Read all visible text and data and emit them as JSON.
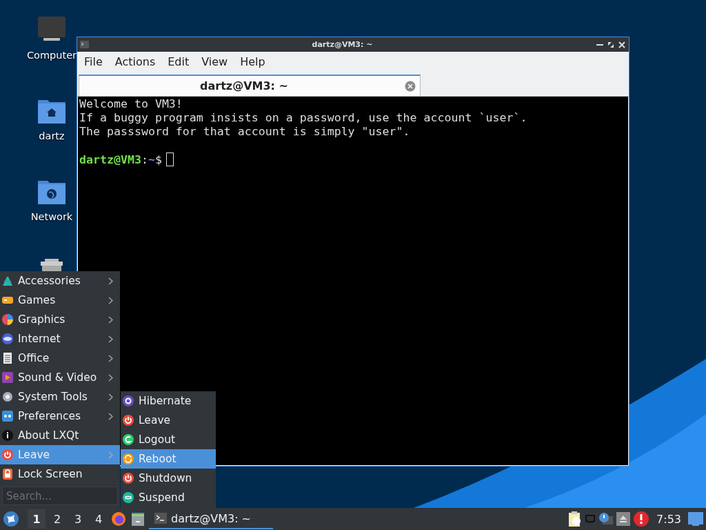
{
  "desktop_icons": [
    {
      "kind": "computer",
      "label": "Computer"
    },
    {
      "kind": "home",
      "label": "dartz"
    },
    {
      "kind": "network",
      "label": "Network"
    },
    {
      "kind": "trash"
    }
  ],
  "terminal": {
    "title": "dartz@VM3: ~",
    "menu": [
      "File",
      "Actions",
      "Edit",
      "View",
      "Help"
    ],
    "tabs": [
      {
        "label": "dartz@VM3: ~",
        "selected": true
      }
    ],
    "lines": [
      "Welcome to VM3!",
      "If a buggy program insists on a password, use the account `user`.",
      "The passsword for that account is simply \"user\"."
    ],
    "prompt": {
      "user_host": "dartz@VM3",
      "separator": ":",
      "path": "~",
      "symbol": "$"
    }
  },
  "start_menu": {
    "items": [
      {
        "kind": "accessories",
        "label": "Accessories",
        "has_submenu": true,
        "selected": false
      },
      {
        "kind": "games",
        "label": "Games",
        "has_submenu": true,
        "selected": false
      },
      {
        "kind": "graphics",
        "label": "Graphics",
        "has_submenu": true,
        "selected": false
      },
      {
        "kind": "internet",
        "label": "Internet",
        "has_submenu": true,
        "selected": false
      },
      {
        "kind": "office",
        "label": "Office",
        "has_submenu": true,
        "selected": false
      },
      {
        "kind": "sound-video",
        "label": "Sound & Video",
        "has_submenu": true,
        "selected": false
      },
      {
        "kind": "system-tools",
        "label": "System Tools",
        "has_submenu": true,
        "selected": false
      },
      {
        "kind": "preferences",
        "label": "Preferences",
        "has_submenu": true,
        "selected": false
      },
      {
        "kind": "about",
        "label": "About LXQt",
        "has_submenu": false,
        "selected": false
      },
      {
        "kind": "leave",
        "label": "Leave",
        "has_submenu": true,
        "selected": true
      },
      {
        "kind": "lock",
        "label": "Lock Screen",
        "has_submenu": false,
        "selected": false
      }
    ],
    "search": {
      "placeholder": "Search..."
    },
    "submenu": [
      {
        "kind": "hibernate",
        "label": "Hibernate",
        "selected": false
      },
      {
        "kind": "leave",
        "label": "Leave",
        "selected": false
      },
      {
        "kind": "logout",
        "label": "Logout",
        "selected": false
      },
      {
        "kind": "reboot",
        "label": "Reboot",
        "selected": true
      },
      {
        "kind": "shutdown",
        "label": "Shutdown",
        "selected": false
      },
      {
        "kind": "suspend",
        "label": "Suspend",
        "selected": false
      }
    ]
  },
  "taskbar": {
    "desktops": [
      {
        "label": "1",
        "selected": true
      },
      {
        "label": "2",
        "selected": false
      },
      {
        "label": "3",
        "selected": false
      },
      {
        "label": "4",
        "selected": false
      }
    ],
    "tasks": [
      {
        "label": "dartz@VM3: ~",
        "selected": true
      }
    ],
    "clock": "7:53"
  }
}
